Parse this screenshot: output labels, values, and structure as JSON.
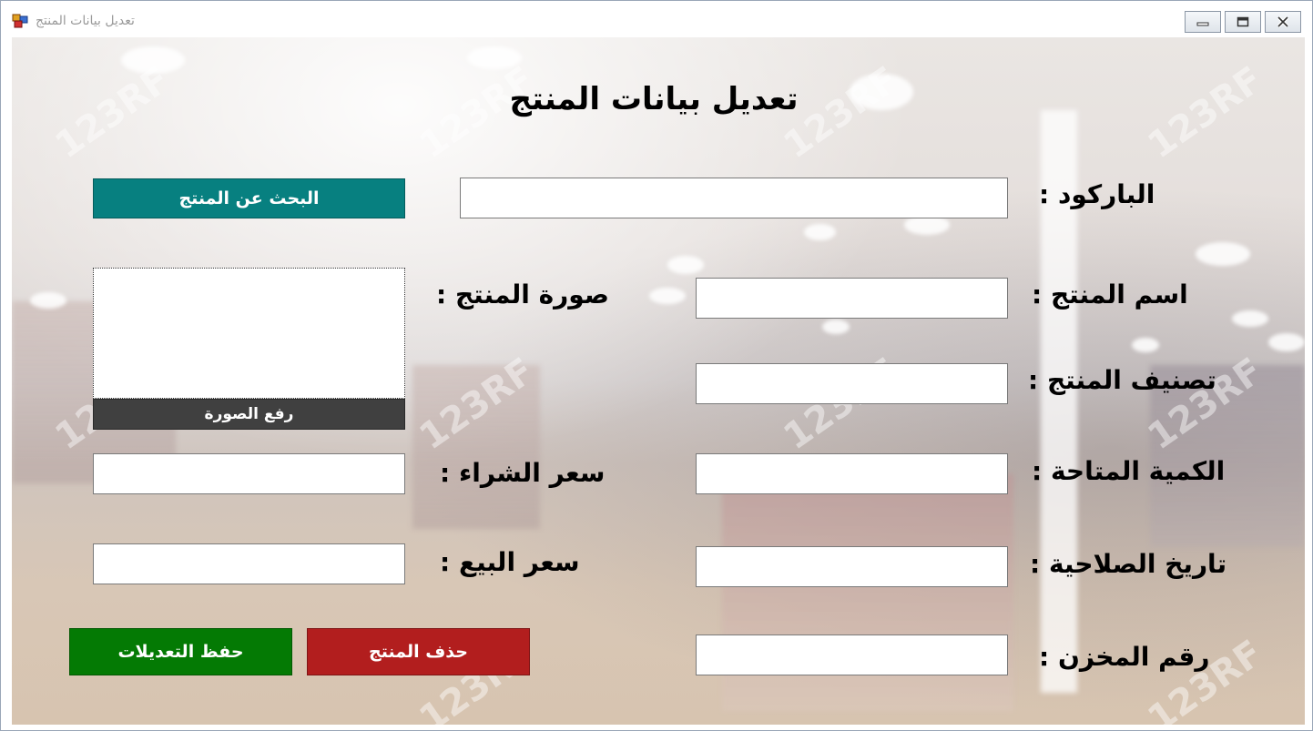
{
  "window": {
    "title": "تعديل بيانات المنتج"
  },
  "form": {
    "heading": "تعديل بيانات المنتج",
    "barcode_label": "الباركود :",
    "name_label": "اسم المنتج :",
    "category_label": "تصنيف المنتج :",
    "quantity_label": "الكمية المتاحة :",
    "expiry_label": "تاريخ الصلاحية :",
    "store_label": "رقم المخزن :",
    "image_label": "صورة المنتج :",
    "purchase_price_label": "سعر الشراء :",
    "sale_price_label": "سعر البيع :",
    "barcode_value": "",
    "name_value": "",
    "category_value": "",
    "quantity_value": "",
    "expiry_value": "",
    "store_value": "",
    "purchase_price_value": "",
    "sale_price_value": ""
  },
  "buttons": {
    "search": "البحث عن المنتج",
    "upload_image": "رفع الصورة",
    "delete": "حذف المنتج",
    "save": "حفظ التعديلات"
  },
  "background": {
    "watermark": "123RF"
  },
  "colors": {
    "search_button": "#078080",
    "upload_button": "#404040",
    "delete_button": "#b21e1e",
    "save_button": "#047a04"
  },
  "icons": {
    "app": "app-window-icon",
    "minimize": "minimize-icon",
    "maximize": "maximize-icon",
    "close": "close-icon"
  }
}
